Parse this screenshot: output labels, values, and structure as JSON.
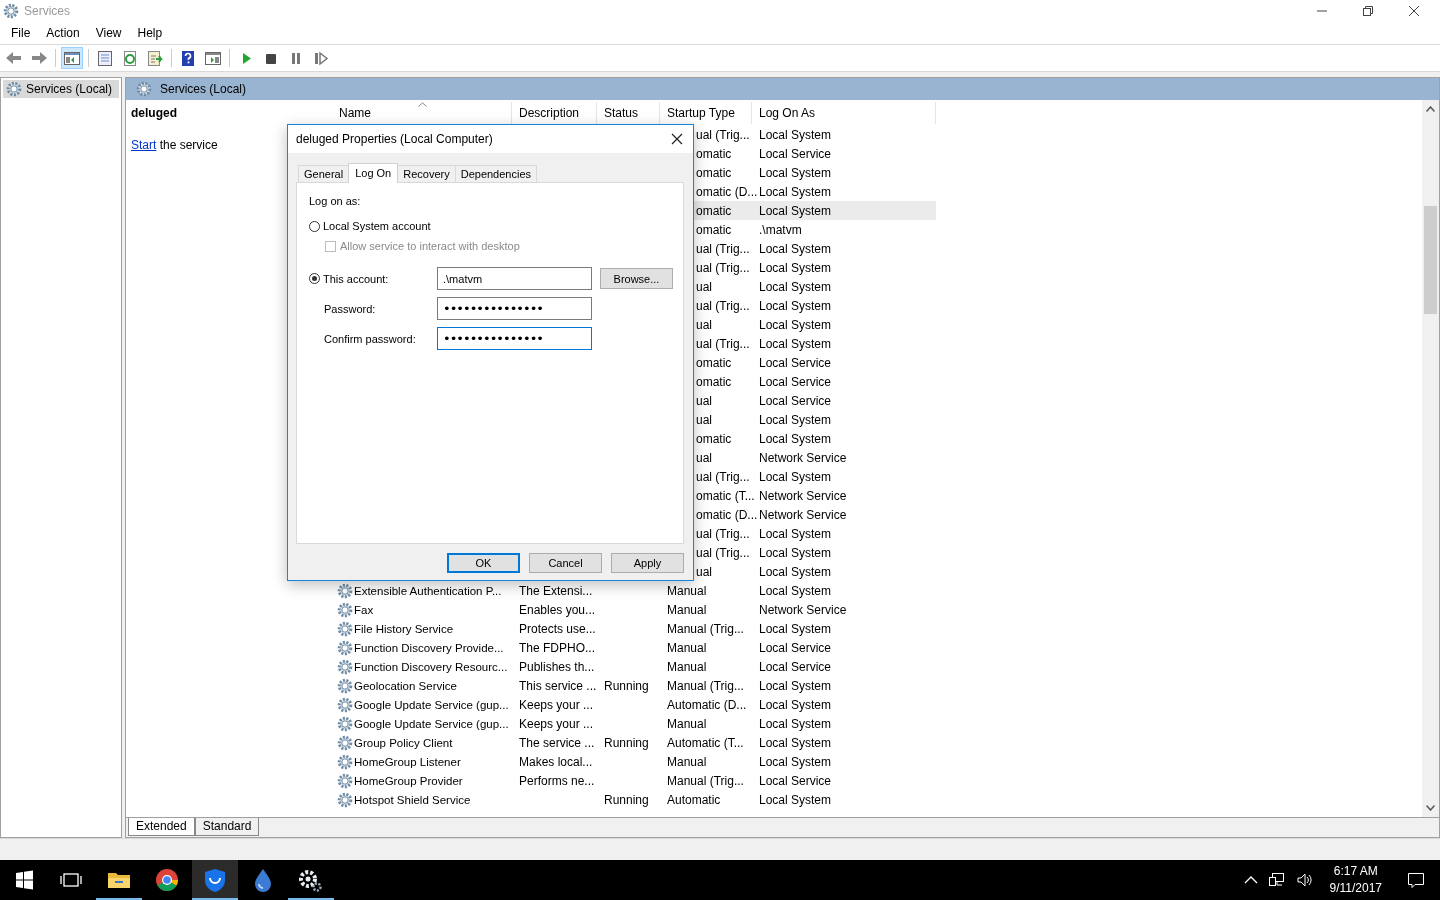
{
  "window": {
    "title": "Services"
  },
  "menu": [
    "File",
    "Action",
    "View",
    "Help"
  ],
  "toolbar": [
    {
      "kind": "back",
      "pressed": false
    },
    {
      "kind": "forward",
      "pressed": false
    },
    {
      "kind": "separator"
    },
    {
      "kind": "console_tree",
      "pressed": true
    },
    {
      "kind": "separator"
    },
    {
      "kind": "properties",
      "pressed": false
    },
    {
      "kind": "refresh",
      "pressed": false
    },
    {
      "kind": "export",
      "pressed": false
    },
    {
      "kind": "separator"
    },
    {
      "kind": "help",
      "pressed": false
    },
    {
      "kind": "action_pane",
      "pressed": false
    },
    {
      "kind": "separator"
    },
    {
      "kind": "play",
      "pressed": false
    },
    {
      "kind": "stop",
      "pressed": false
    },
    {
      "kind": "pause",
      "pressed": false
    },
    {
      "kind": "resume",
      "pressed": false
    }
  ],
  "tree": [
    {
      "label": "Services (Local)",
      "selected": true
    }
  ],
  "pane_header": "Services (Local)",
  "details": {
    "name": "deluged",
    "action_link": "Start",
    "action_rest": " the service"
  },
  "table": {
    "columns": [
      {
        "label": "Name",
        "sorted": true
      },
      {
        "label": "Description",
        "sorted": false
      },
      {
        "label": "Status",
        "sorted": false
      },
      {
        "label": "Startup Type",
        "sorted": false
      },
      {
        "label": "Log On As",
        "sorted": false
      }
    ],
    "rows": [
      {
        "kind": "covered",
        "startup_type": "ual (Trig...",
        "log_on_as": "Local System",
        "selected": false
      },
      {
        "kind": "covered",
        "startup_type": "omatic",
        "log_on_as": "Local Service",
        "selected": false
      },
      {
        "kind": "covered",
        "startup_type": "omatic",
        "log_on_as": "Local System",
        "selected": false
      },
      {
        "kind": "covered",
        "startup_type": "omatic (D...",
        "log_on_as": "Local System",
        "selected": false
      },
      {
        "kind": "covered",
        "startup_type": "omatic",
        "log_on_as": "Local System",
        "selected": true
      },
      {
        "kind": "covered",
        "startup_type": "omatic",
        "log_on_as": ".\\matvm",
        "selected": false
      },
      {
        "kind": "covered",
        "startup_type": "ual (Trig...",
        "log_on_as": "Local System",
        "selected": false
      },
      {
        "kind": "covered",
        "startup_type": "ual (Trig...",
        "log_on_as": "Local System",
        "selected": false
      },
      {
        "kind": "covered",
        "startup_type": "ual",
        "log_on_as": "Local System",
        "selected": false
      },
      {
        "kind": "covered",
        "startup_type": "ual (Trig...",
        "log_on_as": "Local System",
        "selected": false
      },
      {
        "kind": "covered",
        "startup_type": "ual",
        "log_on_as": "Local System",
        "selected": false
      },
      {
        "kind": "covered",
        "startup_type": "ual (Trig...",
        "log_on_as": "Local System",
        "selected": false
      },
      {
        "kind": "covered",
        "startup_type": "omatic",
        "log_on_as": "Local Service",
        "selected": false
      },
      {
        "kind": "covered",
        "startup_type": "omatic",
        "log_on_as": "Local Service",
        "selected": false
      },
      {
        "kind": "covered",
        "startup_type": "ual",
        "log_on_as": "Local Service",
        "selected": false
      },
      {
        "kind": "covered",
        "startup_type": "ual",
        "log_on_as": "Local System",
        "selected": false
      },
      {
        "kind": "covered",
        "startup_type": "omatic",
        "log_on_as": "Local System",
        "selected": false
      },
      {
        "kind": "covered",
        "startup_type": "ual",
        "log_on_as": "Network Service",
        "selected": false
      },
      {
        "kind": "covered",
        "startup_type": "ual (Trig...",
        "log_on_as": "Local System",
        "selected": false
      },
      {
        "kind": "covered",
        "startup_type": "omatic (T...",
        "log_on_as": "Network Service",
        "selected": false
      },
      {
        "kind": "covered",
        "startup_type": "omatic (D...",
        "log_on_as": "Network Service",
        "selected": false
      },
      {
        "kind": "covered",
        "startup_type": "ual (Trig...",
        "log_on_as": "Local System",
        "selected": false
      },
      {
        "kind": "covered",
        "startup_type": "ual (Trig...",
        "log_on_as": "Local System",
        "selected": false
      },
      {
        "kind": "covered",
        "startup_type": "ual",
        "log_on_as": "Local System",
        "selected": false
      },
      {
        "kind": "full",
        "name": "Extensible Authentication P...",
        "description": "The Extensi...",
        "startup_type": "Manual",
        "log_on_as": "Local System",
        "selected": false
      },
      {
        "kind": "full",
        "name": "Fax",
        "description": "Enables you...",
        "startup_type": "Manual",
        "log_on_as": "Network Service",
        "selected": false
      },
      {
        "kind": "full",
        "name": "File History Service",
        "description": "Protects use...",
        "startup_type": "Manual (Trig...",
        "log_on_as": "Local System",
        "selected": false
      },
      {
        "kind": "full",
        "name": "Function Discovery Provide...",
        "description": "The FDPHO...",
        "startup_type": "Manual",
        "log_on_as": "Local Service",
        "selected": false
      },
      {
        "kind": "full",
        "name": "Function Discovery Resourc...",
        "description": "Publishes th...",
        "startup_type": "Manual",
        "log_on_as": "Local Service",
        "selected": false
      },
      {
        "kind": "full",
        "name": "Geolocation Service",
        "description": "This service ...",
        "status": "Running",
        "startup_type": "Manual (Trig...",
        "log_on_as": "Local System",
        "selected": false
      },
      {
        "kind": "full",
        "name": "Google Update Service (gup...",
        "description": "Keeps your ...",
        "startup_type": "Automatic (D...",
        "log_on_as": "Local System",
        "selected": false
      },
      {
        "kind": "full",
        "name": "Google Update Service (gup...",
        "description": "Keeps your ...",
        "startup_type": "Manual",
        "log_on_as": "Local System",
        "selected": false
      },
      {
        "kind": "full",
        "name": "Group Policy Client",
        "description": "The service ...",
        "status": "Running",
        "startup_type": "Automatic (T...",
        "log_on_as": "Local System",
        "selected": false
      },
      {
        "kind": "full",
        "name": "HomeGroup Listener",
        "description": "Makes local...",
        "startup_type": "Manual",
        "log_on_as": "Local System",
        "selected": false
      },
      {
        "kind": "full",
        "name": "HomeGroup Provider",
        "description": "Performs ne...",
        "startup_type": "Manual (Trig...",
        "log_on_as": "Local Service",
        "selected": false
      },
      {
        "kind": "full",
        "name": "Hotspot Shield Service",
        "status": "Running",
        "startup_type": "Automatic",
        "log_on_as": "Local System",
        "selected": false
      }
    ]
  },
  "view_tabs": [
    {
      "label": "Extended",
      "selected": true
    },
    {
      "label": "Standard",
      "selected": false
    }
  ],
  "dialog": {
    "title": "deluged Properties (Local Computer)",
    "tabs": [
      {
        "label": "General",
        "selected": false
      },
      {
        "label": "Log On",
        "selected": true
      },
      {
        "label": "Recovery",
        "selected": false
      },
      {
        "label": "Dependencies",
        "selected": false
      }
    ],
    "group_label": "Log on as:",
    "local_system": {
      "label": "Local System account",
      "selected": false
    },
    "interact": {
      "label": "Allow service to interact with desktop",
      "checked": false,
      "disabled": true
    },
    "this_account": {
      "label": "This account:",
      "selected": true,
      "value": ".\\matvm"
    },
    "browse": "Browse...",
    "password": {
      "label": "Password:",
      "value": "•••••••••••••••",
      "focused": false
    },
    "confirm": {
      "label": "Confirm password:",
      "value": "•••••••••••••••",
      "focused": true
    },
    "buttons": [
      {
        "label": "OK",
        "default": true
      },
      {
        "label": "Cancel",
        "default": false
      },
      {
        "label": "Apply",
        "default": false
      }
    ]
  },
  "taskbar": {
    "apps": [
      {
        "kind": "task_view",
        "running": false,
        "highlighted": false
      },
      {
        "kind": "explorer",
        "running": true,
        "highlighted": false
      },
      {
        "kind": "chrome",
        "running": false,
        "highlighted": false
      },
      {
        "kind": "shield",
        "running": true,
        "highlighted": true
      },
      {
        "kind": "drop",
        "running": false,
        "highlighted": false
      },
      {
        "kind": "gear",
        "running": true,
        "highlighted": false
      }
    ],
    "time": "6:17 AM",
    "date": "9/11/2017"
  }
}
